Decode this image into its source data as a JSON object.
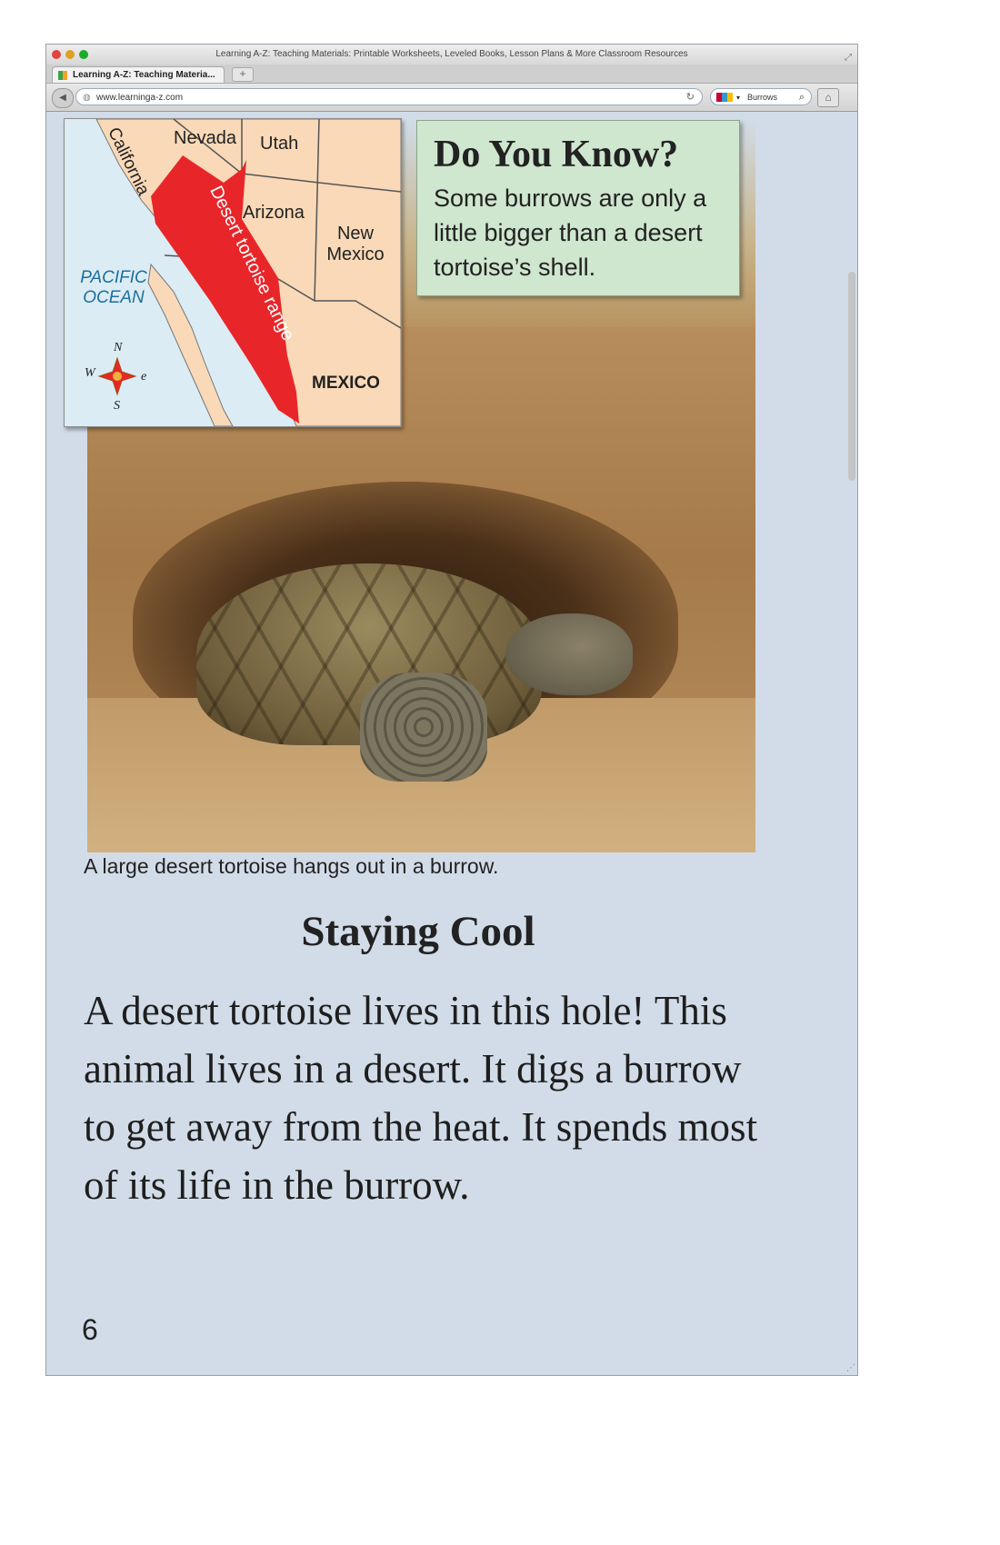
{
  "browser": {
    "window_title": "Learning A-Z: Teaching Materials: Printable Worksheets, Leveled Books, Lesson Plans & More Classroom Resources",
    "tab_label": "Learning A-Z: Teaching Materia...",
    "new_tab_label": "+",
    "url": "www.learninga-z.com",
    "search_value": "Burrows"
  },
  "map": {
    "states": [
      "Nevada",
      "Utah",
      "Arizona",
      "New Mexico"
    ],
    "california": "California",
    "ocean_line1": "PACIFIC",
    "ocean_line2": "OCEAN",
    "country": "MEXICO",
    "range_label": "Desert tortoise range",
    "compass": {
      "n": "N",
      "s": "S",
      "e": "e",
      "w": "W"
    },
    "range_color": "#e8262a",
    "land_color": "#f9d9b8",
    "water_color": "#dbecf5"
  },
  "do_you_know": {
    "title": "Do You Know?",
    "text": "Some burrows are only a little bigger than a desert tortoise’s shell."
  },
  "caption": "A large desert tortoise hangs out in a burrow.",
  "heading": "Staying Cool",
  "body": "A desert tortoise lives in this hole! This animal lives in a desert. It digs a burrow to get away from the heat. It spends most of its life in the burrow.",
  "page_number": "6"
}
